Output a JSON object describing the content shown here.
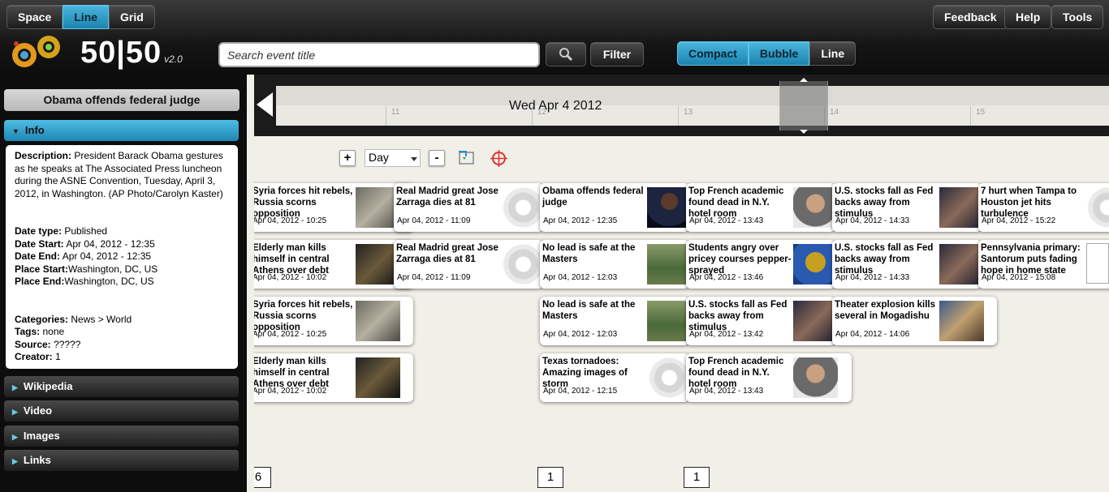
{
  "view_tabs": [
    "Space",
    "Line",
    "Grid"
  ],
  "active_view": "Line",
  "right_buttons": [
    "Feedback",
    "Help",
    "Tools"
  ],
  "brand": {
    "name": "50|50",
    "version": "v2.0"
  },
  "search": {
    "placeholder": "Search event title",
    "filter_label": "Filter"
  },
  "display_modes": [
    "Compact",
    "Bubble",
    "Line"
  ],
  "active_modes": [
    "Compact",
    "Bubble"
  ],
  "sidebar": {
    "event_title": "Obama offends federal judge",
    "info_label": "Info",
    "info": {
      "description_label": "Description:",
      "description": "President Barack Obama gestures as he speaks at The Associated Press luncheon during the ASNE Convention, Tuesday, April 3, 2012, in Washington. (AP Photo/Carolyn Kaster)",
      "date_type_label": "Date type:",
      "date_type": "Published",
      "date_start_label": "Date Start:",
      "date_start": "Apr 04, 2012 - 12:35",
      "date_end_label": "Date End:",
      "date_end": "Apr 04, 2012 - 12:35",
      "place_start_label": "Place Start:",
      "place_start": "Washington, DC, US",
      "place_end_label": "Place End:",
      "place_end": "Washington, DC, US",
      "categories_label": "Categories:",
      "categories": "News > World",
      "tags_label": "Tags:",
      "tags": "none",
      "source_label": "Source:",
      "source": "?????",
      "creator_label": "Creator:",
      "creator": "1"
    },
    "sections": [
      "Wikipedia",
      "Video",
      "Images",
      "Links"
    ]
  },
  "timeline": {
    "date_label": "Wed Apr 4 2012",
    "ticks": [
      "11",
      "12",
      "13",
      "14",
      "15"
    ],
    "zoom_unit": "Day",
    "zoom_in": "+",
    "zoom_out": "-"
  },
  "events": [
    {
      "title": "Syria forces hit rebels, Russia scorns opposition",
      "date": "Apr 04, 2012 - 10:25",
      "thumb": "photo"
    },
    {
      "title": "Elderly man kills himself in central Athens over debt",
      "date": "Apr 04, 2012 - 10:02",
      "thumb": "photo"
    },
    {
      "title": "Syria forces hit rebels, Russia scorns opposition",
      "date": "Apr 04, 2012 - 10:25",
      "thumb": "photo"
    },
    {
      "title": "Elderly man kills himself in central Athens over debt",
      "date": "Apr 04, 2012 - 10:02",
      "thumb": "photo"
    },
    {
      "title": "Real Madrid great Jose Zarraga dies at 81",
      "date": "Apr 04, 2012 - 11:09",
      "thumb": "gear"
    },
    {
      "title": "Real Madrid great Jose Zarraga dies at 81",
      "date": "Apr 04, 2012 - 11:09",
      "thumb": "gear"
    },
    {
      "title": "Obama offends federal judge",
      "date": "Apr 04, 2012 - 12:35",
      "thumb": "photo"
    },
    {
      "title": "No lead is safe at the Masters",
      "date": "Apr 04, 2012 - 12:03",
      "thumb": "photo"
    },
    {
      "title": "No lead is safe at the Masters",
      "date": "Apr 04, 2012 - 12:03",
      "thumb": "photo"
    },
    {
      "title": "Texas tornadoes: Amazing images of storm",
      "date": "Apr 04, 2012 - 12:15",
      "thumb": "gear"
    },
    {
      "title": "Top French academic found dead in N.Y. hotel room",
      "date": "Apr 04, 2012 - 13:43",
      "thumb": "photo"
    },
    {
      "title": "Students angry over pricey courses pepper-sprayed",
      "date": "Apr 04, 2012 - 13:46",
      "thumb": "photo"
    },
    {
      "title": "U.S. stocks fall as Fed backs away from stimulus",
      "date": "Apr 04, 2012 - 13:42",
      "thumb": "photo"
    },
    {
      "title": "Top French academic found dead in N.Y. hotel room",
      "date": "Apr 04, 2012 - 13:43",
      "thumb": "photo"
    },
    {
      "title": "U.S. stocks fall as Fed backs away from stimulus",
      "date": "Apr 04, 2012 - 14:33",
      "thumb": "photo"
    },
    {
      "title": "U.S. stocks fall as Fed backs away from stimulus",
      "date": "Apr 04, 2012 - 14:33",
      "thumb": "photo"
    },
    {
      "title": "Theater explosion kills several in Mogadishu",
      "date": "Apr 04, 2012 - 14:06",
      "thumb": "photo"
    },
    {
      "title": "7 hurt when Tampa to Houston jet hits turbulence",
      "date": "Apr 04, 2012 - 15:22",
      "thumb": "gear"
    },
    {
      "title": "Pennsylvania primary: Santorum puts fading hope in home state",
      "date": "Apr 04, 2012 - 15:08",
      "thumb": "doc"
    }
  ],
  "counts": [
    "6",
    "1",
    "1"
  ],
  "colors": {
    "accent": "#2a9fcf",
    "header_dark": "#151515",
    "timeline_bg": "#f1f0e8"
  }
}
